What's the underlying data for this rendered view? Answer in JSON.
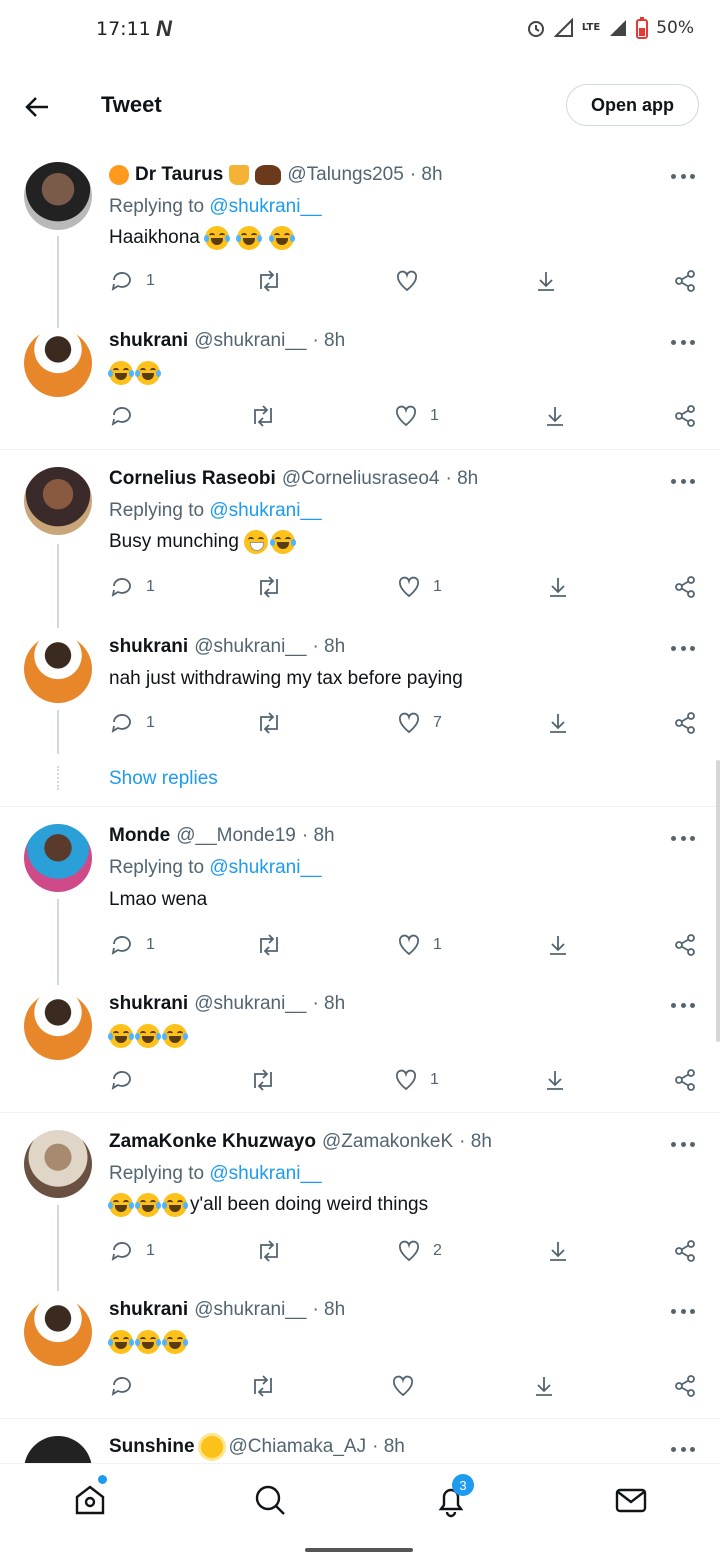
{
  "status": {
    "time": "17:11",
    "network_label": "LTE",
    "battery": "50%"
  },
  "header": {
    "title": "Tweet",
    "open_app": "Open app"
  },
  "replying_prefix": "Replying to",
  "tweets": [
    {
      "name": "Dr Taurus",
      "handle": "@Talungs205",
      "time": "· 8h",
      "replying_to": "@shukrani__",
      "text": "Haaikhona",
      "emoji_count": 3,
      "replies": "1",
      "likes": ""
    },
    {
      "name": "shukrani",
      "handle": "@shukrani__",
      "time": "· 8h",
      "text": "",
      "emoji_count": 2,
      "replies": "",
      "likes": "1"
    },
    {
      "name": "Cornelius Raseobi",
      "handle": "@Corneliusraseo4",
      "time": "· 8h",
      "replying_to": "@shukrani__",
      "text": "Busy munching",
      "emoji_count": 2,
      "replies": "1",
      "likes": "1"
    },
    {
      "name": "shukrani",
      "handle": "@shukrani__",
      "time": "· 8h",
      "text": "nah just withdrawing my tax before paying",
      "replies": "1",
      "likes": "7"
    },
    {
      "name": "Monde",
      "handle": "@__Monde19",
      "time": "· 8h",
      "replying_to": "@shukrani__",
      "text": "Lmao wena",
      "replies": "1",
      "likes": "1"
    },
    {
      "name": "shukrani",
      "handle": "@shukrani__",
      "time": "· 8h",
      "text": "",
      "emoji_count": 3,
      "replies": "",
      "likes": "1"
    },
    {
      "name": "ZamaKonke Khuzwayo",
      "handle": "@ZamakonkeK",
      "time": "· 8h",
      "replying_to": "@shukrani__",
      "text": "y'all been doing weird things",
      "emoji_count": 3,
      "replies": "1",
      "likes": "2"
    },
    {
      "name": "shukrani",
      "handle": "@shukrani__",
      "time": "· 8h",
      "text": "",
      "emoji_count": 3,
      "replies": "",
      "likes": ""
    },
    {
      "name": "Sunshine",
      "handle": "@Chiamaka_AJ",
      "time": "· 8h"
    }
  ],
  "show_replies": "Show replies",
  "nav": {
    "notifications_badge": "3"
  },
  "colors": {
    "accent": "#1d9bf0",
    "text": "#0f1419",
    "secondary": "#536471"
  }
}
